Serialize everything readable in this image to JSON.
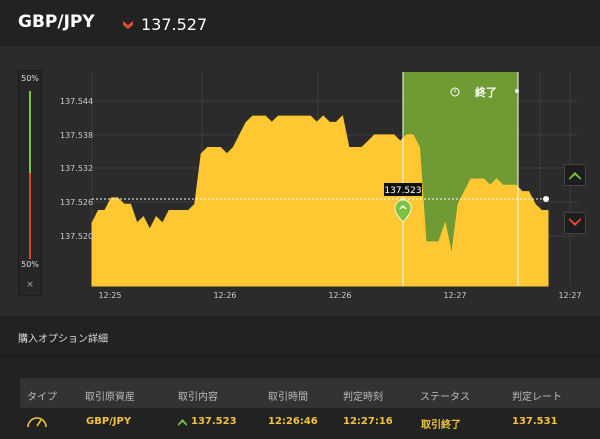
{
  "header": {
    "pair": "GBP/JPY",
    "price": "137.527",
    "direction_icon": "down-arrow-icon"
  },
  "gauge": {
    "top_label": "50%",
    "bottom_label": "50%",
    "close_label": "×"
  },
  "chart": {
    "type": "area",
    "color_fill": "#ffc832",
    "color_expiry_zone": "#6f9a34",
    "ytick_labels": [
      "137.544",
      "137.538",
      "137.532",
      "137.526",
      "137.520"
    ],
    "xtick_labels": [
      "12:25",
      "12:26",
      "12:26",
      "12:27",
      "12:27"
    ],
    "current_value_label": "137.523",
    "expiry_label": "終了",
    "ylim": [
      137.514,
      137.548
    ]
  },
  "chart_data": {
    "type": "area",
    "title": "",
    "xlabel": "",
    "ylabel": "",
    "x_labels": [
      "12:25",
      "12:26",
      "12:26",
      "12:27",
      "12:27"
    ],
    "ylim": [
      137.514,
      137.548
    ],
    "series": [
      {
        "values": [
          137.524,
          137.526,
          137.526,
          137.528,
          137.528,
          137.527,
          137.527,
          137.524,
          137.525,
          137.523,
          137.525,
          137.524,
          137.526,
          137.526,
          137.526,
          137.526,
          137.527,
          137.535,
          137.536,
          137.536,
          137.536,
          137.535,
          137.536,
          137.538,
          137.54,
          137.541,
          137.541,
          137.541,
          137.54,
          137.541,
          137.541,
          137.541,
          137.541,
          137.541,
          137.541,
          137.54,
          137.541,
          137.54,
          137.54,
          137.541,
          137.536,
          137.536,
          137.536,
          137.537,
          137.538,
          137.538,
          137.538,
          137.538,
          137.537,
          137.538,
          137.538,
          137.536,
          137.521,
          137.521,
          137.521,
          137.524,
          137.519,
          137.527,
          137.529,
          137.531,
          137.531,
          137.531,
          137.53,
          137.531,
          137.53,
          137.53,
          137.53,
          137.529,
          137.529,
          137.527,
          137.526,
          137.526
        ]
      }
    ]
  },
  "controls": {
    "high_icon": "up-chevron-icon",
    "low_icon": "down-chevron-icon"
  },
  "section": {
    "title": "購入オプション詳細"
  },
  "table": {
    "headers": [
      "タイプ",
      "取引原資産",
      "取引内容",
      "取引時間",
      "判定時刻",
      "ステータス",
      "判定レート"
    ],
    "row": {
      "type_icon": "gauge-icon",
      "asset": "GBP/JPY",
      "direction_icon": "up-arrow-icon",
      "content": "137.523",
      "trade_time": "12:26:46",
      "judge_time": "12:27:16",
      "status": "取引終了",
      "rate": "137.531"
    }
  }
}
